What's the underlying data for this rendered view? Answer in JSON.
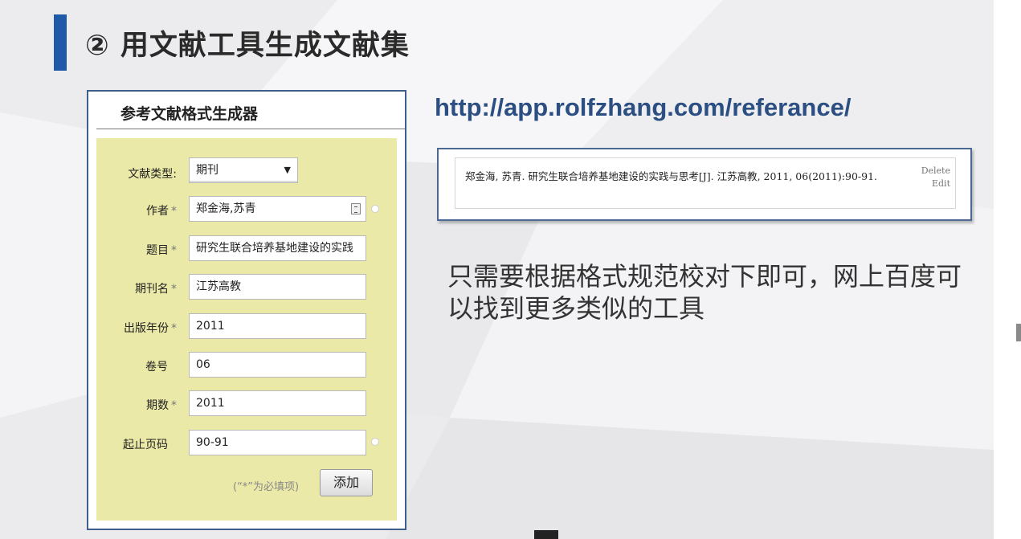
{
  "slide": {
    "title": "② 用文献工具生成文献集",
    "url": "http://app.rolfzhang.com/referance/",
    "note": "只需要根据格式规范校对下即可，网上百度可以找到更多类似的工具",
    "accent_color": "#1f5aa8"
  },
  "generator": {
    "title": "参考文献格式生成器",
    "fields": {
      "type": {
        "label": "文献类型:",
        "value": "期刊",
        "icon": "dropdown-caret-icon"
      },
      "author": {
        "label": "作者",
        "required": "*",
        "value": "郑金海,苏青",
        "icon": "contact-card-icon"
      },
      "title": {
        "label": "题目",
        "required": "*",
        "value": "研究生联合培养基地建设的实践"
      },
      "journal": {
        "label": "期刊名",
        "required": "*",
        "value": "江苏高教"
      },
      "year": {
        "label": "出版年份",
        "required": "*",
        "value": "2011"
      },
      "volume": {
        "label": "卷号",
        "value": "06"
      },
      "issue": {
        "label": "期数",
        "required": "*",
        "value": "2011"
      },
      "pages": {
        "label": "起止页码",
        "value": "90-91"
      }
    },
    "hint": "(“*”为必填项)",
    "add_label": "添加"
  },
  "reference": {
    "text": "郑金海, 苏青. 研究生联合培养基地建设的实践与思考[J]. 江苏高教, 2011, 06(2011):90-91.",
    "delete_label": "Delete",
    "edit_label": "Edit"
  }
}
